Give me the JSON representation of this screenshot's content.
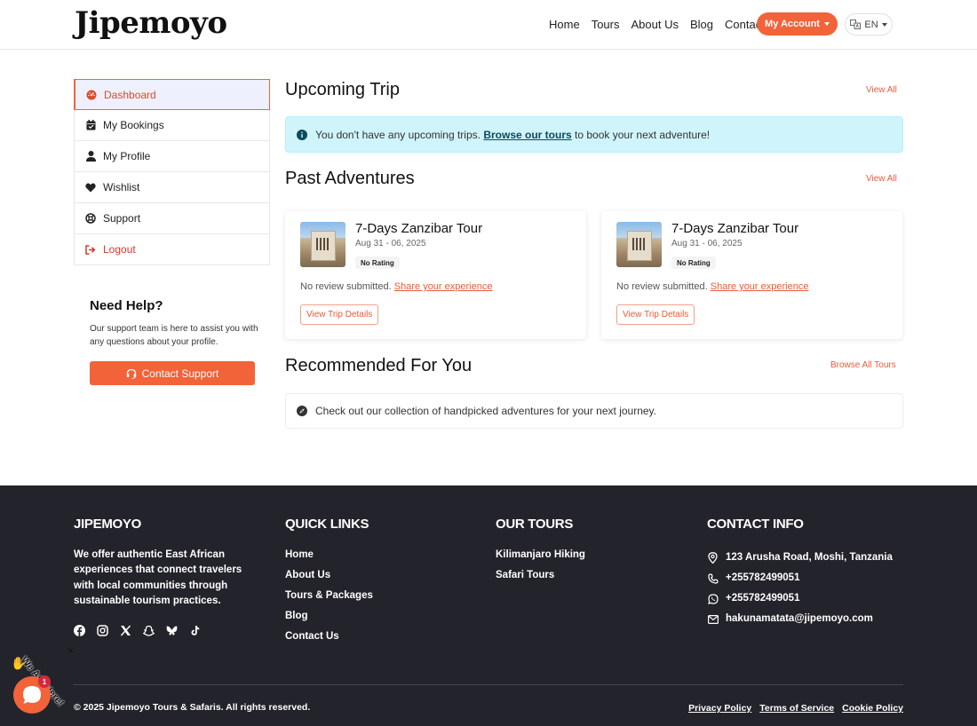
{
  "header": {
    "logo": "Jipemoyo",
    "nav": [
      "Home",
      "Tours",
      "About Us",
      "Blog",
      "Contact"
    ],
    "account_label": "My Account",
    "lang_label": "EN"
  },
  "sidebar": {
    "items": [
      {
        "label": "Dashboard",
        "icon": "dashboard-icon"
      },
      {
        "label": "My Bookings",
        "icon": "calendar-check-icon"
      },
      {
        "label": "My Profile",
        "icon": "user-icon"
      },
      {
        "label": "Wishlist",
        "icon": "heart-icon"
      },
      {
        "label": "Support",
        "icon": "lifebuoy-icon"
      },
      {
        "label": "Logout",
        "icon": "logout-icon"
      }
    ],
    "help_title": "Need Help?",
    "help_text": "Our support team is here to assist you with any questions about your profile.",
    "support_button": "Contact Support"
  },
  "main": {
    "upcoming": {
      "title": "Upcoming Trip",
      "view_all": "View All",
      "alert_prefix": "You don't have any upcoming trips.",
      "alert_link": "Browse our tours",
      "alert_suffix": "to book your next adventure!"
    },
    "past": {
      "title": "Past Adventures",
      "view_all": "View All",
      "cards": [
        {
          "title": "7-Days Zanzibar Tour",
          "date": "Aug 31 - 06, 2025",
          "rating": "No Rating",
          "review_text": "No review submitted.",
          "review_link": "Share your experience",
          "button": "View Trip Details"
        },
        {
          "title": "7-Days Zanzibar Tour",
          "date": "Aug 31 - 06, 2025",
          "rating": "No Rating",
          "review_text": "No review submitted.",
          "review_link": "Share your experience",
          "button": "View Trip Details"
        }
      ]
    },
    "recommended": {
      "title": "Recommended For You",
      "browse_all": "Browse All Tours",
      "message": "Check out our collection of handpicked adventures for your next journey."
    }
  },
  "footer": {
    "brand_title": "JIPEMOYO",
    "about": "We offer authentic East African experiences that connect travelers with local communities through sustainable tourism practices.",
    "socials": [
      "facebook-icon",
      "instagram-icon",
      "x-icon",
      "snapchat-icon",
      "bluesky-icon",
      "tiktok-icon"
    ],
    "quick_links_title": "QUICK LINKS",
    "quick_links": [
      "Home",
      "About Us",
      "Tours & Packages",
      "Blog",
      "Contact Us"
    ],
    "tours_title": "OUR TOURS",
    "tours": [
      "Kilimanjaro Hiking",
      "Safari Tours"
    ],
    "contact_title": "CONTACT INFO",
    "contact": {
      "address": "123 Arusha Road, Moshi, Tanzania",
      "phone": "+255782499051",
      "whatsapp": "+255782499051",
      "email": "hakunamatata@jipemoyo.com"
    },
    "copyright": "© 2025 Jipemoyo Tours & Safaris. All rights reserved.",
    "legal": [
      "Privacy Policy",
      "Terms of Service",
      "Cookie Policy"
    ]
  },
  "chat": {
    "label": "We Are Here!",
    "badge": "1",
    "close": "×"
  },
  "colors": {
    "accent": "#f2633a",
    "footer_bg": "#23242b",
    "info_bg": "#cff4fc"
  }
}
